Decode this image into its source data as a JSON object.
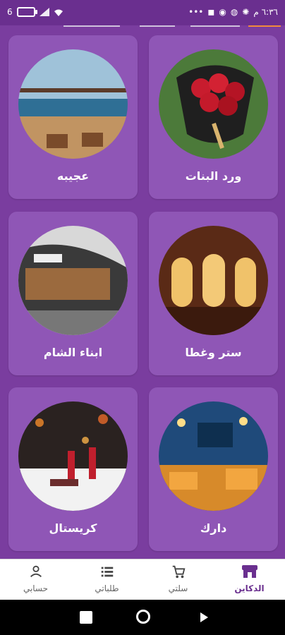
{
  "status": {
    "left_text": "6",
    "right_time": "٦:٣٦ م"
  },
  "shops": [
    {
      "name": "عجيبه"
    },
    {
      "name": "ورد البنات"
    },
    {
      "name": "ابناء الشام"
    },
    {
      "name": "ستر وغطا"
    },
    {
      "name": "كريستال"
    },
    {
      "name": "دارك"
    }
  ],
  "nav": {
    "items": [
      {
        "label": "حسابي",
        "icon": "user-icon"
      },
      {
        "label": "طلباتي",
        "icon": "list-icon"
      },
      {
        "label": "سلتي",
        "icon": "cart-icon"
      },
      {
        "label": "الدكاين",
        "icon": "store-icon"
      }
    ],
    "active_index": 3
  },
  "colors": {
    "primary": "#6a2f8f",
    "background": "#7a3d9f",
    "card": "#8f56b6"
  }
}
